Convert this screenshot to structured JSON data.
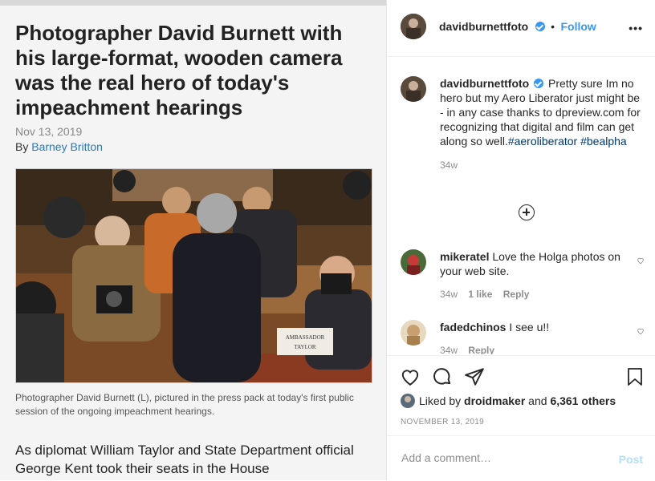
{
  "article": {
    "headline": "Photographer David Burnett with his large-format, wooden camera was the real hero of today's impeachment hearings",
    "date": "Nov 13, 2019",
    "by_label": "By ",
    "author": "Barney Britton",
    "photo_sign_line1": "AMBASSADOR",
    "photo_sign_line2": "TAYLOR",
    "caption": "Photographer David Burnett (L), pictured in the press pack at today's first public session of the ongoing impeachment hearings.",
    "body": "As diplomat William Taylor and State Department official George Kent took their seats in the House"
  },
  "post": {
    "username": "davidburnettfoto",
    "follow_label": "Follow",
    "separator": "•",
    "more_icon": "more-options-icon",
    "caption_text": "Pretty sure Im no hero but my Aero Liberator just might be - in any case thanks to dpreview.com for recognizing that digital and film can get along so well.",
    "tags": [
      "#aeroliberator",
      "#bealpha"
    ],
    "caption_age": "34w",
    "load_more_icon": "plus-circle-icon",
    "comments": [
      {
        "username": "mikeratel",
        "text": "Love the Holga photos on your web site.",
        "age": "34w",
        "likes": "1 like",
        "reply": "Reply"
      },
      {
        "username": "fadedchinos",
        "text": "I see u!!",
        "age": "34w",
        "likes": "",
        "reply": "Reply"
      }
    ],
    "liked_by_prefix": "Liked by ",
    "liked_by_user": "droidmaker",
    "liked_by_and": " and ",
    "liked_by_others": "6,361 others",
    "date": "NOVEMBER 13, 2019",
    "add_comment_placeholder": "Add a comment…",
    "post_label": "Post"
  },
  "colors": {
    "accent": "#3897f0",
    "post_disabled": "#b2dffc",
    "link": "#2a7ab8"
  }
}
